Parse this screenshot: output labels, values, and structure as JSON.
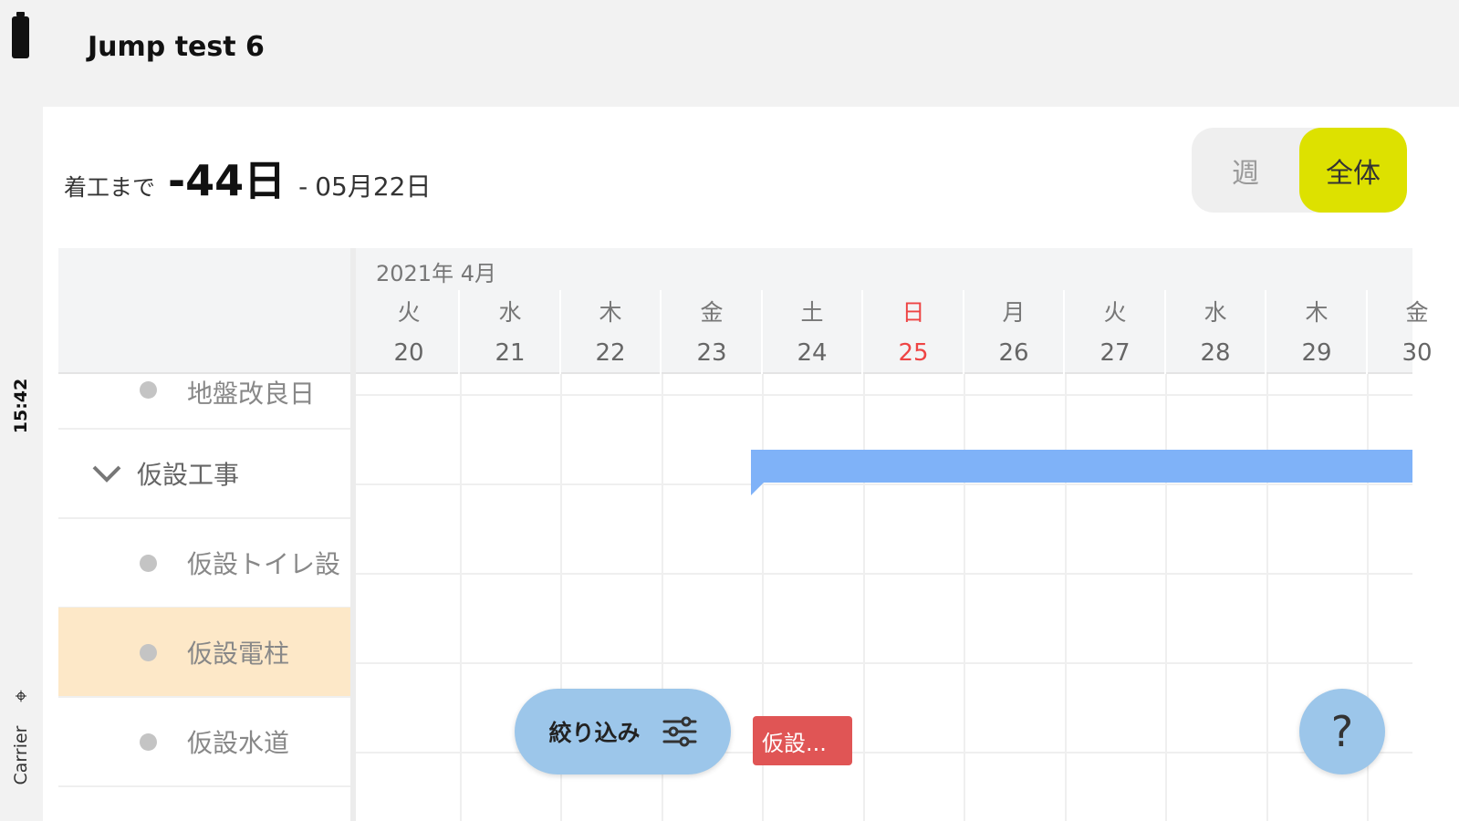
{
  "status": {
    "time": "15:42",
    "carrier": "Carrier"
  },
  "app": {
    "title": "Jump test 6"
  },
  "countdown": {
    "label": "着工まで",
    "days": "-44日",
    "separator": "-",
    "date": "05月22日"
  },
  "view_toggle": {
    "week_label": "週",
    "all_label": "全体",
    "active": "all"
  },
  "calendar": {
    "month": "2021年 4月",
    "days": [
      {
        "dow": "火",
        "num": "20",
        "sunday": false
      },
      {
        "dow": "水",
        "num": "21",
        "sunday": false
      },
      {
        "dow": "木",
        "num": "22",
        "sunday": false
      },
      {
        "dow": "金",
        "num": "23",
        "sunday": false
      },
      {
        "dow": "土",
        "num": "24",
        "sunday": false
      },
      {
        "dow": "日",
        "num": "25",
        "sunday": true
      },
      {
        "dow": "月",
        "num": "26",
        "sunday": false
      },
      {
        "dow": "火",
        "num": "27",
        "sunday": false
      },
      {
        "dow": "水",
        "num": "28",
        "sunday": false
      },
      {
        "dow": "木",
        "num": "29",
        "sunday": false
      },
      {
        "dow": "金",
        "num": "30",
        "sunday": false
      }
    ]
  },
  "tasks": [
    {
      "label": "地盤改良日",
      "type": "item"
    },
    {
      "label": "仮設工事",
      "type": "group"
    },
    {
      "label": "仮設トイレ設",
      "type": "item"
    },
    {
      "label": "仮設電柱",
      "type": "item",
      "highlighted": true
    },
    {
      "label": "仮設水道",
      "type": "item"
    }
  ],
  "chip": {
    "label": "仮設..."
  },
  "filter_button": {
    "label": "絞り込み"
  },
  "help_button": {
    "label": "?"
  },
  "colors": {
    "accent": "#dde100",
    "bar": "#7fb2f8",
    "chip": "#e05555",
    "highlight": "#fde8c8",
    "fab": "#9cc6ea"
  },
  "icons": {
    "battery": "battery-icon",
    "wifi": "wifi-icon",
    "chevron": "chevron-down-icon",
    "filter": "sliders-icon"
  }
}
